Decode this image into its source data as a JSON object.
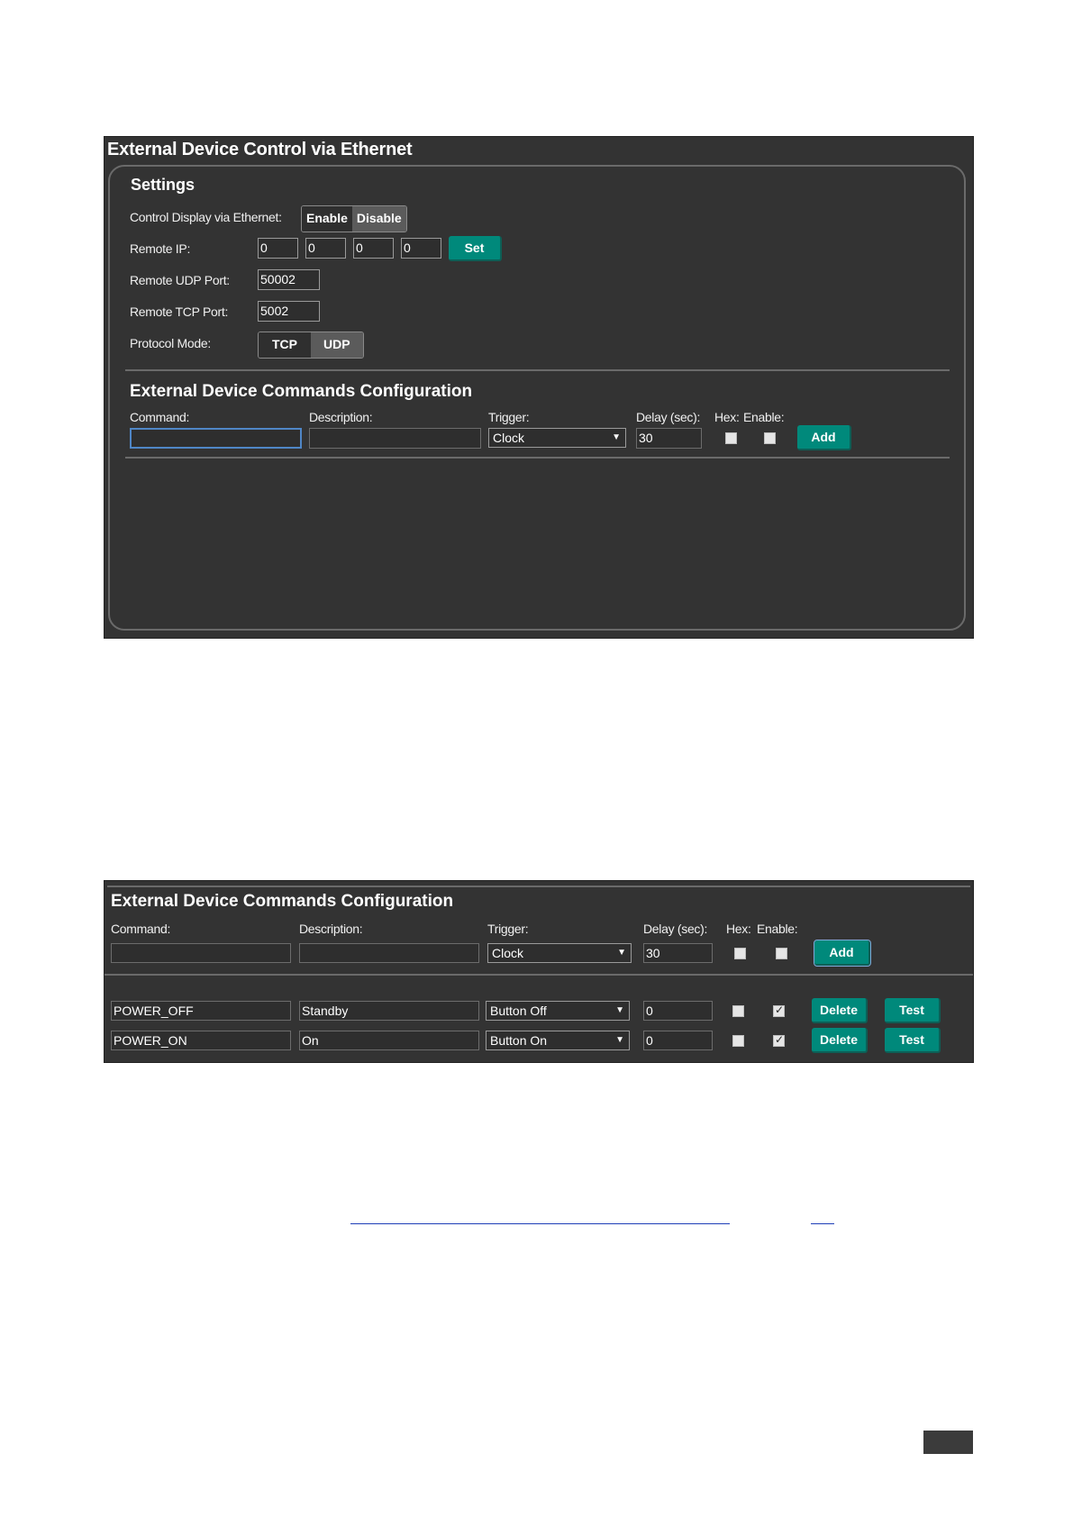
{
  "screenshot1": {
    "window_title": "External Device Control via Ethernet",
    "settings": {
      "title": "Settings",
      "control_display_label": "Control Display via Ethernet:",
      "enable_label": "Enable",
      "disable_label": "Disable",
      "remote_ip_label": "Remote IP:",
      "ip_octets": [
        "0",
        "0",
        "0",
        "0"
      ],
      "set_label": "Set",
      "udp_port_label": "Remote UDP Port:",
      "udp_port_value": "50002",
      "tcp_port_label": "Remote TCP Port:",
      "tcp_port_value": "5002",
      "protocol_label": "Protocol Mode:",
      "tcp_label": "TCP",
      "udp_label": "UDP"
    },
    "commands": {
      "title": "External Device Commands Configuration",
      "command_label": "Command:",
      "description_label": "Description:",
      "trigger_label": "Trigger:",
      "delay_label": "Delay (sec):",
      "hex_label": "Hex:",
      "enable_label": "Enable:",
      "command_value": "",
      "description_value": "",
      "trigger_value": "Clock",
      "delay_value": "30",
      "add_label": "Add"
    }
  },
  "screenshot2": {
    "title": "External Device Commands Configuration",
    "command_label": "Command:",
    "description_label": "Description:",
    "trigger_label": "Trigger:",
    "delay_label": "Delay (sec):",
    "hex_label": "Hex:",
    "enable_label": "Enable:",
    "new_trigger_value": "Clock",
    "new_delay_value": "30",
    "add_label": "Add",
    "delete_label": "Delete",
    "test_label": "Test",
    "rows": [
      {
        "command": "POWER_OFF",
        "description": "Standby",
        "trigger": "Button Off",
        "delay": "0",
        "hex": false,
        "enable": true
      },
      {
        "command": "POWER_ON",
        "description": "On",
        "trigger": "Button On",
        "delay": "0",
        "hex": false,
        "enable": true
      }
    ]
  },
  "colors": {
    "panel_bg": "#333333",
    "accent_button": "#00897b",
    "link_underline": "#1f3fb7"
  }
}
